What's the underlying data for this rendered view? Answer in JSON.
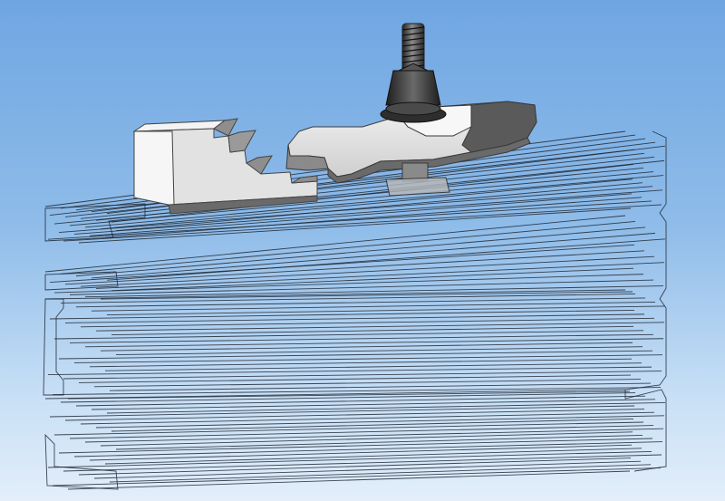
{
  "colors": {
    "bg_top": "#6fa6e2",
    "bg_bottom": "#e3eefa",
    "wireframe": "#1f2733",
    "part_light": "#dcdcdc",
    "part_mid": "#a9a9a9",
    "part_dark": "#5e5e5e",
    "bolt": "#3a3a3a"
  },
  "parts": [
    {
      "name": "aluminium-t-slot-profile",
      "render": "wireframe"
    },
    {
      "name": "stepped-clamp-block",
      "render": "shaded"
    },
    {
      "name": "clamp-strap",
      "render": "shaded"
    },
    {
      "name": "flange-nut",
      "render": "shaded"
    },
    {
      "name": "threaded-stud",
      "render": "shaded"
    },
    {
      "name": "t-slot-nut",
      "render": "shaded"
    }
  ]
}
